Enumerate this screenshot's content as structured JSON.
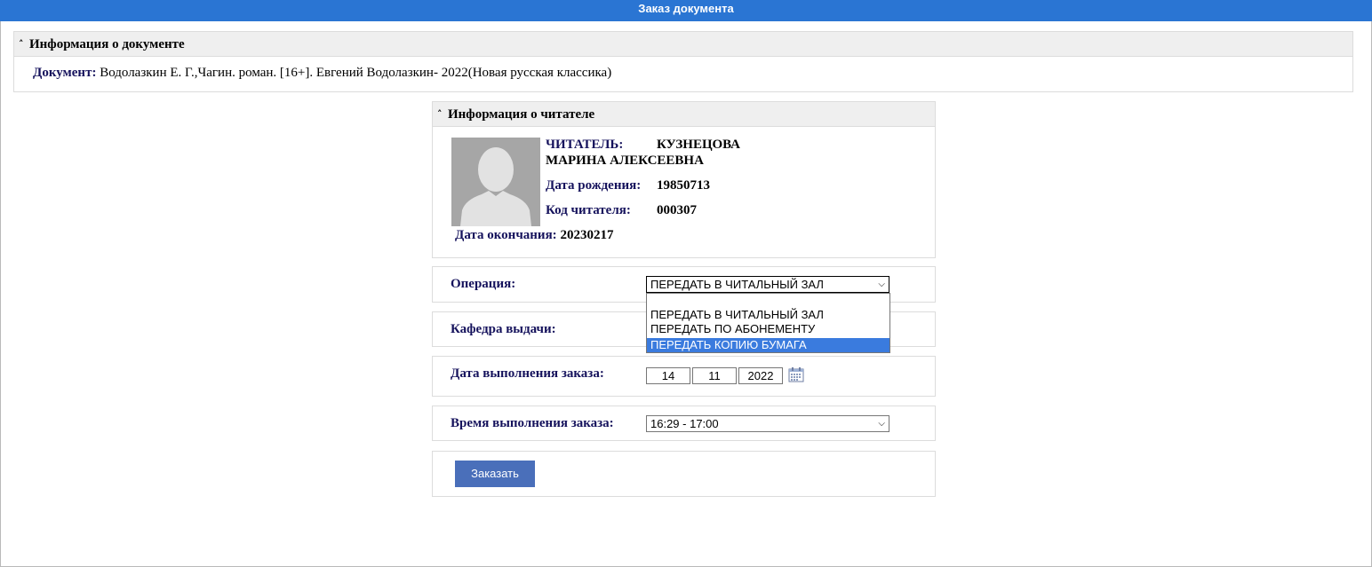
{
  "window": {
    "title": "Заказ документа"
  },
  "document_panel": {
    "header": "Информация о документе",
    "doc_label": "Документ:",
    "doc_value": "Водолазкин Е. Г.,Чагин. роман. [16+]. Евгений Водолазкин- 2022(Новая русская классика)"
  },
  "reader_panel": {
    "header": "Информация о читателе",
    "reader_label": "ЧИТАТЕЛЬ:",
    "reader_name_1": "КУЗНЕЦОВА",
    "reader_name_2": "МАРИНА АЛЕКСЕЕВНА",
    "birth_label": "Дата рождения:",
    "birth_value": "19850713",
    "code_label": "Код читателя:",
    "code_value": "000307",
    "end_label": "Дата окончания:",
    "end_value": "20230217"
  },
  "form": {
    "operation_label": "Операция:",
    "operation_selected": "ПЕРЕДАТЬ В ЧИТАЛЬНЫЙ ЗАЛ",
    "operation_options": [
      "",
      "ПЕРЕДАТЬ В ЧИТАЛЬНЫЙ ЗАЛ",
      "ПЕРЕДАТЬ ПО АБОНЕМЕНТУ",
      "ПЕРЕДАТЬ КОПИЮ БУМАГА"
    ],
    "operation_highlighted_index": 3,
    "department_label": "Кафедра выдачи:",
    "date_label": "Дата выполнения заказа:",
    "date_day": "14",
    "date_month": "11",
    "date_year": "2022",
    "time_label": "Время выполнения заказа:",
    "time_selected": "16:29 - 17:00",
    "submit_label": "Заказать"
  },
  "icons": {
    "collapse": "double-chevron-up-icon",
    "calendar": "calendar-icon",
    "avatar": "user-silhouette-icon",
    "dropdown": "chevron-down-icon"
  },
  "colors": {
    "topbar": "#2a75d3",
    "label": "#15125c",
    "button": "#4a6fba",
    "highlight": "#3a7bde"
  }
}
